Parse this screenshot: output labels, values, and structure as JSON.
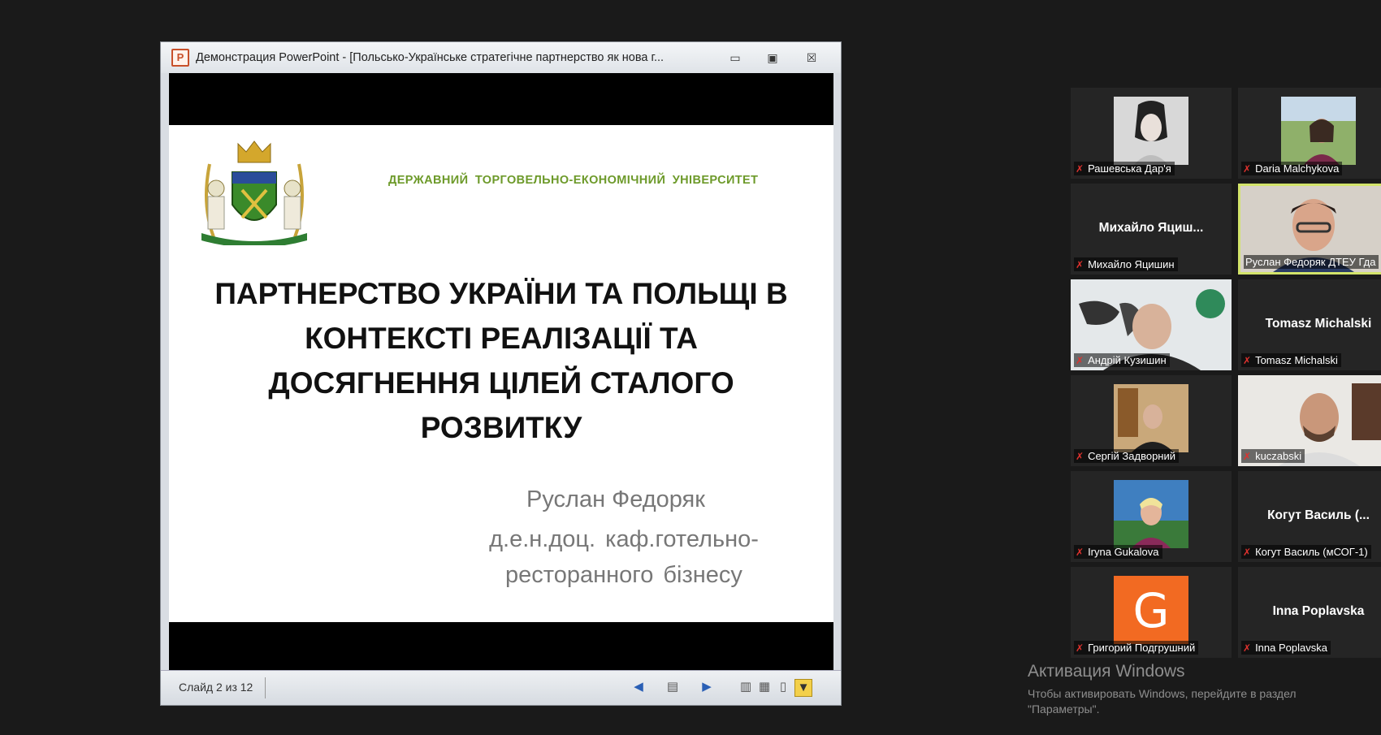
{
  "window": {
    "title": "Демонстрация PowerPoint - [Польсько-Українське стратегічне партнерство як нова г...",
    "app_icon_letter": "P",
    "minimize": "▭",
    "maximize": "▣",
    "close": "☒"
  },
  "slide": {
    "university": "ДЕРЖАВНИЙ ТОРГОВЕЛЬНО-ЕКОНОМІЧНИЙ УНІВЕРСИТЕТ",
    "title": "ПАРТНЕРСТВО УКРАЇНИ ТА ПОЛЬЩІ В КОНТЕКСТІ РЕАЛІЗАЦІЇ ТА ДОСЯГНЕННЯ ЦІЛЕЙ СТАЛОГО РОЗВИТКУ",
    "author": "Руслан Федоряк",
    "position": "д.е.н.доц. каф.готельно-ресторанного бізнесу"
  },
  "status_bar": {
    "slide_counter": "Слайд 2 из 12"
  },
  "participants": [
    {
      "label": "Рашевська Дар'я",
      "display": "photo",
      "big_name": ""
    },
    {
      "label": "Daria Malchykova",
      "display": "photo",
      "big_name": ""
    },
    {
      "label": "Михайло Яцишин",
      "display": "name",
      "big_name": "Михайло Яциш..."
    },
    {
      "label": "Руслан Федоряк ДТЕУ Гда",
      "display": "photo",
      "big_name": "",
      "active": true
    },
    {
      "label": "Андрій Кузишин",
      "display": "photo",
      "big_name": ""
    },
    {
      "label": "Tomasz Michalski",
      "display": "name",
      "big_name": "Tomasz Michalski"
    },
    {
      "label": "Сергій Задворний",
      "display": "photo",
      "big_name": ""
    },
    {
      "label": "kuczabski",
      "display": "photo",
      "big_name": ""
    },
    {
      "label": "Iryna Gukalova",
      "display": "photo",
      "big_name": ""
    },
    {
      "label": "Когут Василь (мСОГ-1)",
      "display": "name",
      "big_name": "Когут Василь (..."
    },
    {
      "label": "Григорий Подгрушний",
      "display": "avatar",
      "big_name": "",
      "avatar_letter": "G",
      "avatar_color": "#f26a22"
    },
    {
      "label": "Inna Poplavska",
      "display": "name",
      "big_name": "Inna Poplavska"
    }
  ],
  "activation": {
    "title": "Активация Windows",
    "line1": "Чтобы активировать Windows, перейдите в раздел",
    "line2": "\"Параметры\"."
  },
  "colors": {
    "university_green": "#6d9a2a",
    "active_speaker_border": "#d2e36a",
    "muted_mic": "#e0322e"
  }
}
